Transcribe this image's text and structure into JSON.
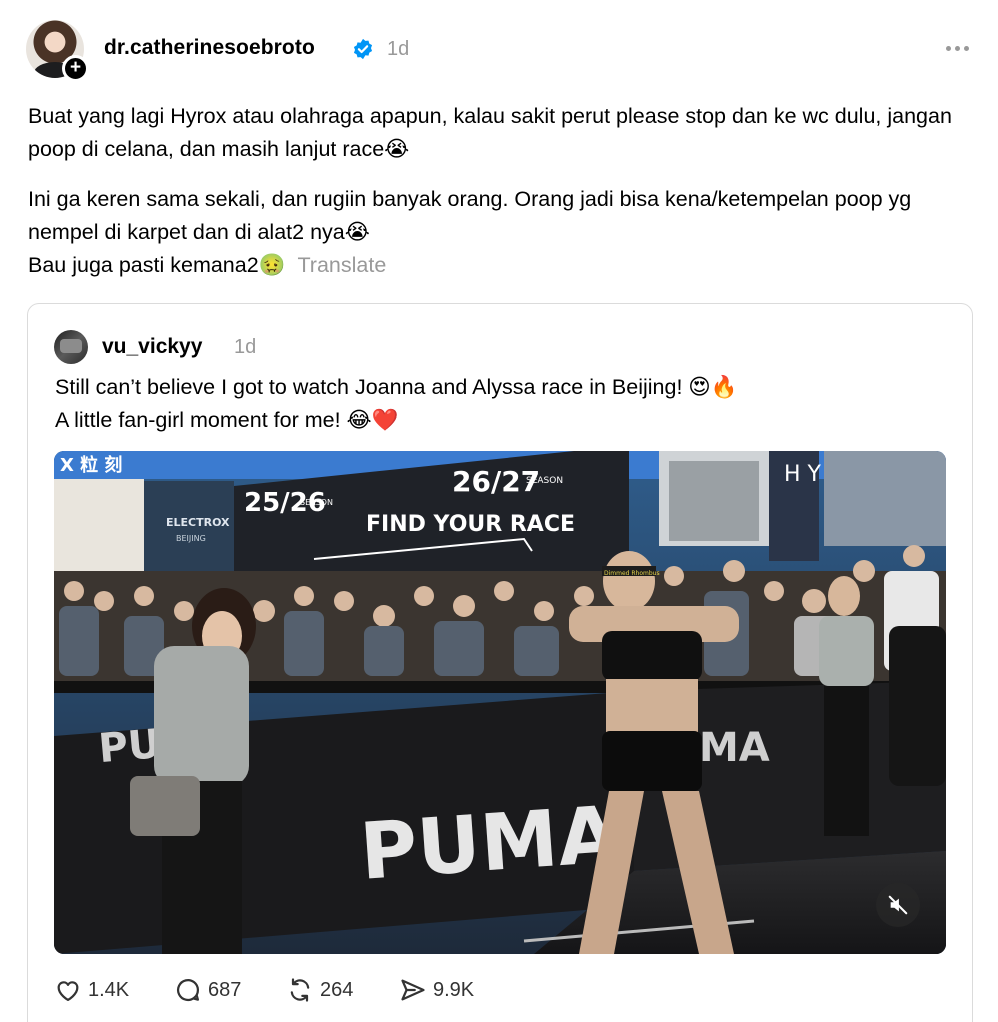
{
  "post": {
    "username": "dr.catherinesoebroto",
    "time": "1d",
    "paragraph1": "Buat yang lagi Hyrox atau olahraga apapun, kalau sakit perut please stop dan ke wc dulu, jangan poop di celana, dan masih lanjut race😭",
    "paragraph2_line1": "Ini ga keren sama sekali, dan rugiin banyak orang. Orang jadi bisa kena/ketempelan poop yg nempel di karpet dan di alat2 nya😭",
    "paragraph2_line2": "Bau juga pasti kemana2🤢",
    "translate_label": "Translate"
  },
  "quoted": {
    "username": "vu_vickyy",
    "time": "1d",
    "line1": "Still can’t believe I got to watch Joanna and Alyssa race in Beijing! 😍🔥",
    "line2": "A little fan-girl moment for me! 😂❤️",
    "video": {
      "sign_left_title": "25/26",
      "sign_left_season": "SEASON",
      "sign_right_title": "26/27",
      "sign_right_season": "SEASON",
      "sign_headline": "FIND YOUR RACE",
      "booth_brand": "ELECTROX",
      "booth_city": "BEIJING",
      "banner_brand": "PUMA",
      "headband_text": "Dimmed Rhombus",
      "top_left_text": "X 粒 刻",
      "side_letters": "H Y"
    },
    "actions": {
      "likes": "1.4K",
      "replies": "687",
      "reposts": "264",
      "shares": "9.9K"
    }
  },
  "colors": {
    "verified": "#0095f6",
    "muted_text": "#999999",
    "border": "#dbdbdb"
  }
}
